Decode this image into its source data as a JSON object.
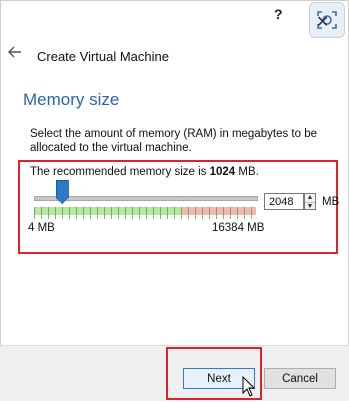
{
  "window": {
    "help": "?",
    "close": "✕"
  },
  "header": {
    "back_icon": "arrow-left-icon",
    "title": "Create Virtual Machine"
  },
  "section": {
    "title": "Memory size",
    "description": "Select the amount of memory (RAM) in megabytes to be allocated to the virtual machine."
  },
  "memory": {
    "recommend_prefix": "The recommended memory size is ",
    "recommended_value": "1024",
    "recommend_suffix": " MB.",
    "current_value": "2048",
    "unit": "MB",
    "min_label": "4 MB",
    "max_label": "16384 MB",
    "slider_fraction": 0.125
  },
  "buttons": {
    "next": "Next",
    "cancel": "Cancel"
  },
  "colors": {
    "accent": "#2a64b0",
    "highlight": "#d9232d",
    "safe_range": "#b7e6a0",
    "danger_range": "#f6b7b0"
  }
}
